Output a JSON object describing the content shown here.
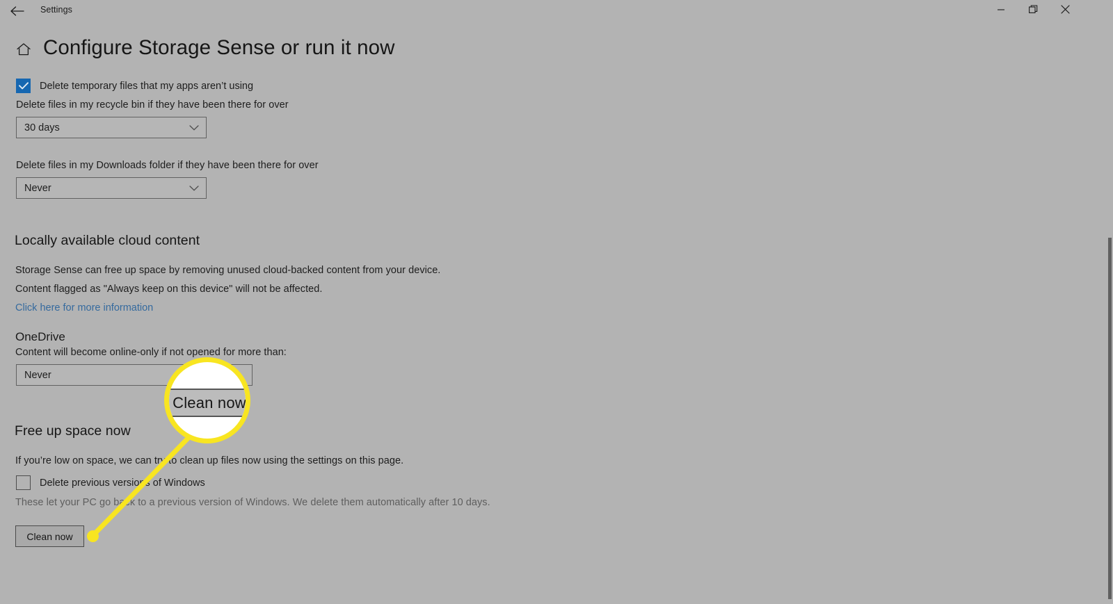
{
  "window": {
    "title": "Settings",
    "back_icon": "back-arrow-icon",
    "minimize_label": "Minimize",
    "maximize_label": "Restore",
    "close_label": "Close"
  },
  "page": {
    "home_icon": "home-icon",
    "title": "Configure Storage Sense or run it now"
  },
  "temp_files": {
    "checkbox_label": "Delete temporary files that my apps aren’t using",
    "checked": true
  },
  "recycle_bin": {
    "label": "Delete files in my recycle bin if they have been there for over",
    "value": "30 days",
    "chevron_icon": "chevron-down-icon"
  },
  "downloads": {
    "label": "Delete files in my Downloads folder if they have been there for over",
    "value": "Never",
    "chevron_icon": "chevron-down-icon"
  },
  "cloud_content": {
    "heading": "Locally available cloud content",
    "line1": "Storage Sense can free up space by removing unused cloud-backed content from your device.",
    "line2": "Content flagged as \"Always keep on this device\" will not be affected.",
    "link": "Click here for more information"
  },
  "onedrive": {
    "heading": "OneDrive",
    "description": "Content will become online-only if not opened for more than:",
    "value": "Never",
    "chevron_icon": "chevron-down-icon"
  },
  "free_up_space": {
    "heading": "Free up space now",
    "description": "If you’re low on space, we can try to clean up files now using the settings on this page.",
    "checkbox_label": "Delete previous versions of Windows",
    "checked": false,
    "note": "These let your PC go back to a previous version of Windows. We delete them automatically after 10 days.",
    "button_label": "Clean now"
  },
  "annotation": {
    "magnified_label": "Clean now",
    "ring_color": "#f8e521",
    "dot_color": "#f8e521"
  },
  "theme": {
    "background": "#b3b3b3",
    "accent": "#1667b1",
    "link": "#356a9e",
    "text": "#1d1d1d",
    "muted_text": "#5e5e5e"
  }
}
